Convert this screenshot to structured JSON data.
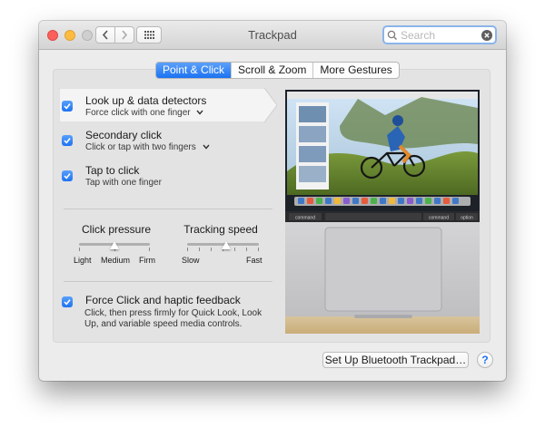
{
  "window": {
    "title": "Trackpad"
  },
  "search": {
    "placeholder": "Search"
  },
  "tabs": [
    {
      "label": "Point & Click",
      "active": true
    },
    {
      "label": "Scroll & Zoom",
      "active": false
    },
    {
      "label": "More Gestures",
      "active": false
    }
  ],
  "options": [
    {
      "title": "Look up & data detectors",
      "subtitle": "Force click with one finger",
      "checked": true,
      "has_menu": true
    },
    {
      "title": "Secondary click",
      "subtitle": "Click or tap with two fingers",
      "checked": true,
      "has_menu": true
    },
    {
      "title": "Tap to click",
      "subtitle": "Tap with one finger",
      "checked": true,
      "has_menu": false
    }
  ],
  "click_pressure": {
    "label": "Click pressure",
    "min_label": "Light",
    "mid_label": "Medium",
    "max_label": "Firm",
    "value_fraction": 0.5
  },
  "tracking_speed": {
    "label": "Tracking speed",
    "min_label": "Slow",
    "max_label": "Fast",
    "value_fraction": 0.55
  },
  "force_click": {
    "title": "Force Click and haptic feedback",
    "description": "Click, then press firmly for Quick Look, Look Up, and variable speed media controls.",
    "checked": true
  },
  "preview_keys": {
    "left_command": "command",
    "right_command": "command",
    "option": "option"
  },
  "footer": {
    "bluetooth_button": "Set Up Bluetooth Trackpad…",
    "help": "?"
  },
  "colors": {
    "accent": "#1b73f2",
    "close": "#fc605c",
    "minimize": "#fdbc40"
  }
}
